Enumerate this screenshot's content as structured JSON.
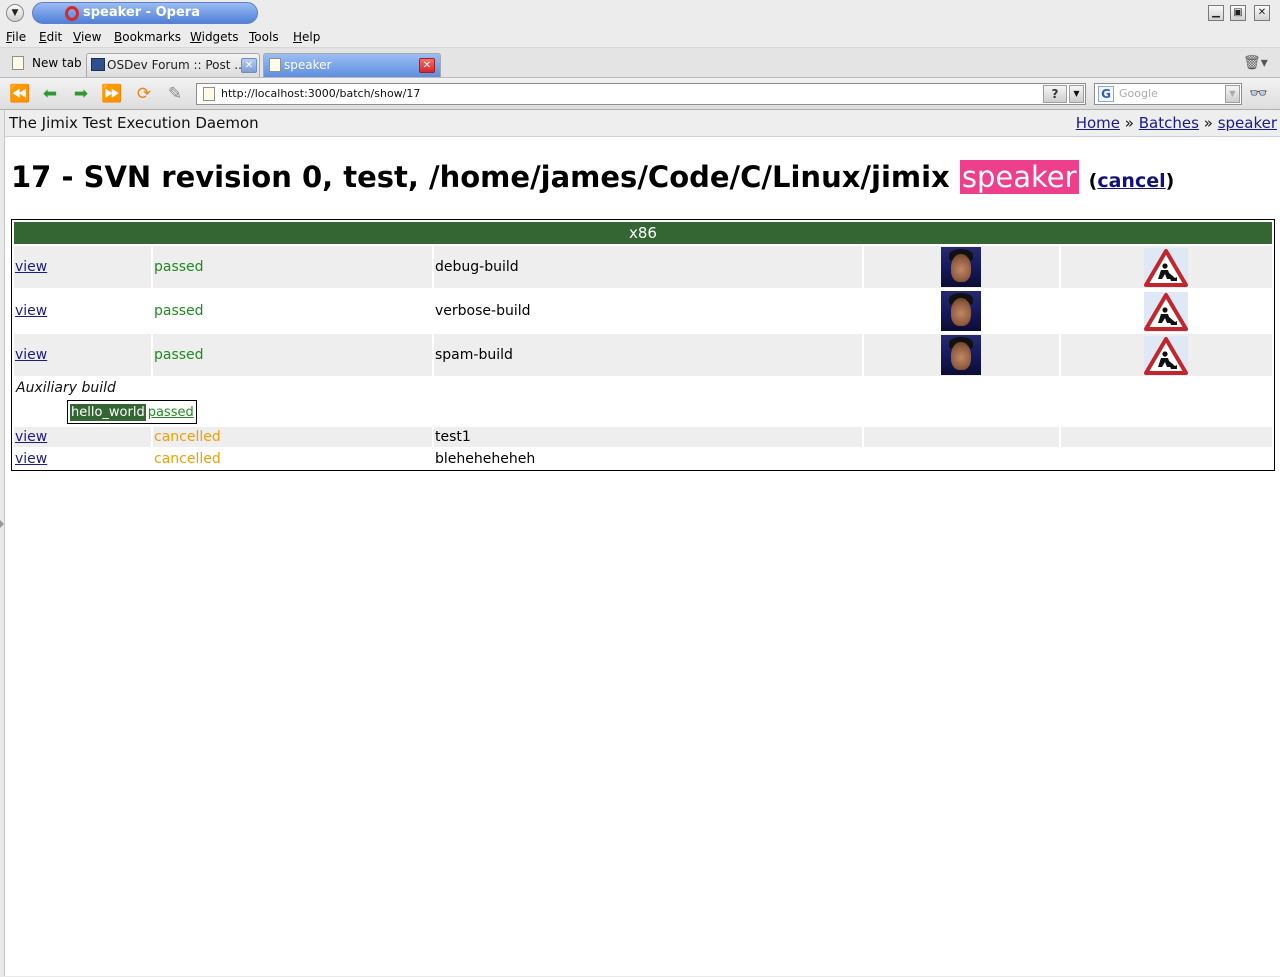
{
  "window": {
    "title": "speaker - Opera",
    "menu_icon": "chevron-down-icon",
    "controls": [
      "minimize-icon",
      "maximize-icon",
      "close-icon"
    ]
  },
  "menubar": {
    "items": [
      "File",
      "Edit",
      "View",
      "Bookmarks",
      "Widgets",
      "Tools",
      "Help"
    ]
  },
  "tabs": {
    "new_tab_label": "New tab",
    "items": [
      {
        "label": "OSDev Forum :: Post ...",
        "active": false
      },
      {
        "label": "speaker",
        "active": true
      }
    ]
  },
  "toolbar": {
    "url": "http://localhost:3000/batch/show/17",
    "help_glyph": "?",
    "search_placeholder": "Google",
    "search_engine_glyph": "G"
  },
  "page": {
    "site_title": "The Jimix Test Execution Daemon",
    "breadcrumbs": [
      "Home",
      "Batches",
      "speaker"
    ],
    "breadcrumb_separator": "»",
    "heading_prefix": "17 - SVN revision 0, test, /home/james/Code/C/Linux/jimix",
    "heading_highlight": "speaker",
    "cancel_label": "cancel",
    "arch": "x86",
    "rows": [
      {
        "link": "view",
        "status": "passed",
        "name": "debug-build"
      },
      {
        "link": "view",
        "status": "passed",
        "name": "verbose-build"
      },
      {
        "link": "view",
        "status": "passed",
        "name": "spam-build"
      }
    ],
    "auxiliary": {
      "label": "Auxiliary build",
      "name": "hello_world",
      "status": "passed"
    },
    "cancelled_rows": [
      {
        "link": "view",
        "status": "cancelled",
        "name": "test1"
      },
      {
        "link": "view",
        "status": "cancelled",
        "name": "bleheheheheh"
      }
    ]
  },
  "colors": {
    "header_green": "#336633",
    "passed": "#1e8c1e",
    "cancelled": "#f0a000",
    "highlight_pink": "#ee3f8d"
  }
}
